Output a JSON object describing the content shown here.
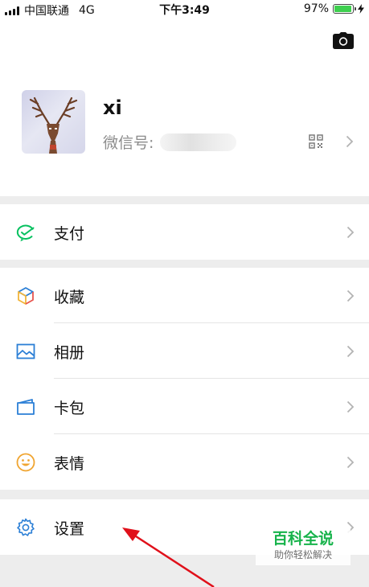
{
  "status_bar": {
    "carrier": "中国联通",
    "network": "4G",
    "time": "下午3:49",
    "battery_text": "97%",
    "battery_level": 0.97,
    "battery_color": "#3ecf4f"
  },
  "profile": {
    "name": "xi",
    "wechat_id_label": "微信号:",
    "camera_icon": "camera-icon",
    "qr_icon": "qr-code-icon"
  },
  "menu": {
    "pay": {
      "label": "支付",
      "icon": "wechat-pay-icon"
    },
    "favorites": {
      "label": "收藏",
      "icon": "cube-icon"
    },
    "album": {
      "label": "相册",
      "icon": "image-icon"
    },
    "card_wallet": {
      "label": "卡包",
      "icon": "wallet-icon"
    },
    "stickers": {
      "label": "表情",
      "icon": "smiley-icon"
    },
    "settings": {
      "label": "设置",
      "icon": "gear-icon"
    }
  },
  "watermark": {
    "title": "百科全说",
    "subtitle": "助你轻松解决"
  },
  "colors": {
    "accent_green": "#07c160",
    "icon_blue": "#2b7fd6",
    "arrow_red": "#e0101a"
  }
}
